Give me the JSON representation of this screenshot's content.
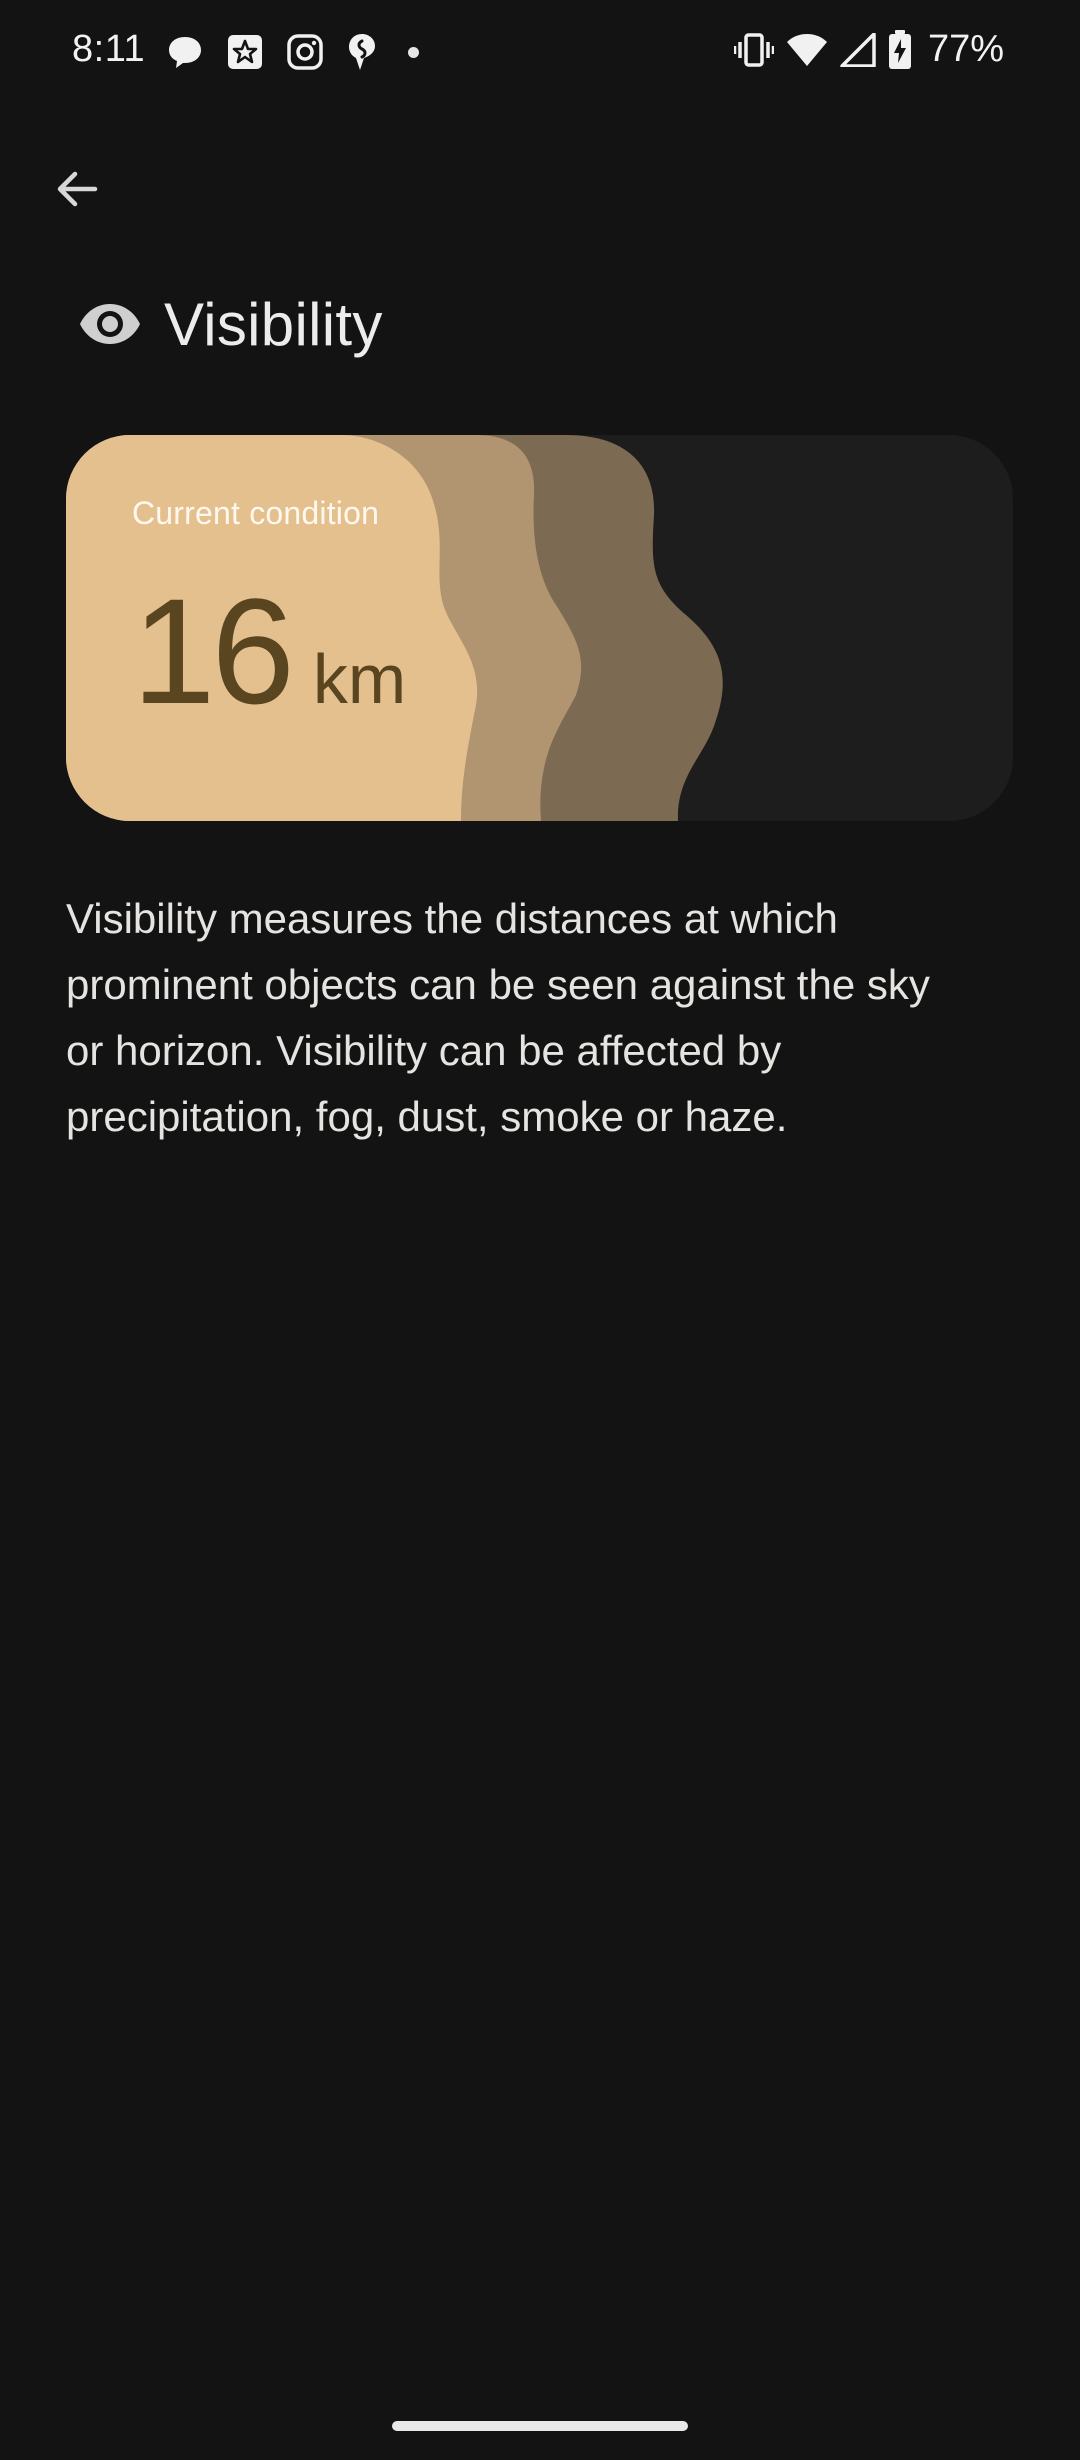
{
  "status_bar": {
    "time": "8:11",
    "battery": "77%",
    "left_icons": [
      "chat-bubble-icon",
      "star-badge-icon",
      "instagram-icon",
      "shazam-icon",
      "notification-dot-icon"
    ],
    "right_icons": [
      "vibrate-icon",
      "wifi-icon",
      "cell-signal-icon",
      "battery-charging-icon"
    ]
  },
  "nav": {
    "back_icon": "arrow-back-icon"
  },
  "header": {
    "icon": "eye-icon",
    "title": "Visibility"
  },
  "card": {
    "label": "Current condition",
    "value": "16",
    "unit": "km",
    "colors": {
      "background": "#1d1d1d",
      "layer_light": "#e4c08f",
      "layer_mid": "#b09570",
      "layer_dark": "#7d6a52",
      "value_text": "#5a4521"
    }
  },
  "description": "Visibility measures the distances at which prominent objects can be seen against the sky or horizon. Visibility can be affected by precipitation, fog, dust, smoke or haze."
}
